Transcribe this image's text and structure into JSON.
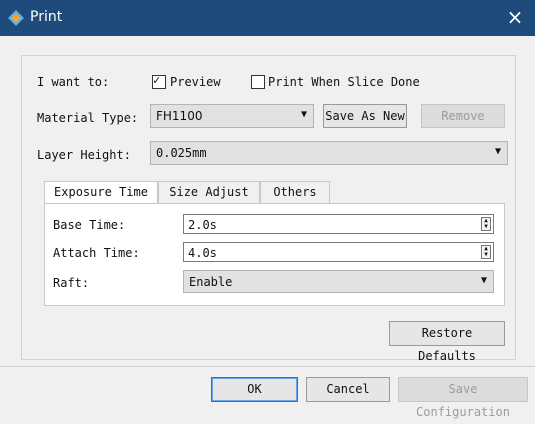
{
  "window": {
    "title": "Print",
    "close_icon": "×",
    "app_icon": "print-app-icon"
  },
  "form": {
    "i_want_to_label": "I want to:",
    "preview": {
      "label": "Preview",
      "checked": true,
      "mark": "✓"
    },
    "print_when_done": {
      "label": "Print When Slice Done",
      "checked": false
    },
    "material_type_label": "Material Type:",
    "material_type_value": "FH1100",
    "save_as_new": "Save As New",
    "remove": "Remove",
    "layer_height_label": "Layer Height:",
    "layer_height_value": "0.025mm"
  },
  "tabs": [
    {
      "label": "Exposure Time",
      "active": true
    },
    {
      "label": "Size Adjust",
      "active": false
    },
    {
      "label": "Others",
      "active": false
    }
  ],
  "exposure": {
    "base_time_label": "Base Time:",
    "base_time_value": "2.0s",
    "attach_time_label": "Attach Time:",
    "attach_time_value": "4.0s",
    "raft_label": "Raft:",
    "raft_value": "Enable",
    "restore_defaults": "Restore Defaults"
  },
  "footer": {
    "ok": "OK",
    "cancel": "Cancel",
    "save_configuration": "Save Configuration"
  },
  "glyphs": {
    "dropdown": "▼",
    "spin_up": "▲",
    "spin_down": "▼"
  },
  "colors": {
    "titlebar": "#1e4b7c",
    "ok_border": "#1e74d6"
  }
}
